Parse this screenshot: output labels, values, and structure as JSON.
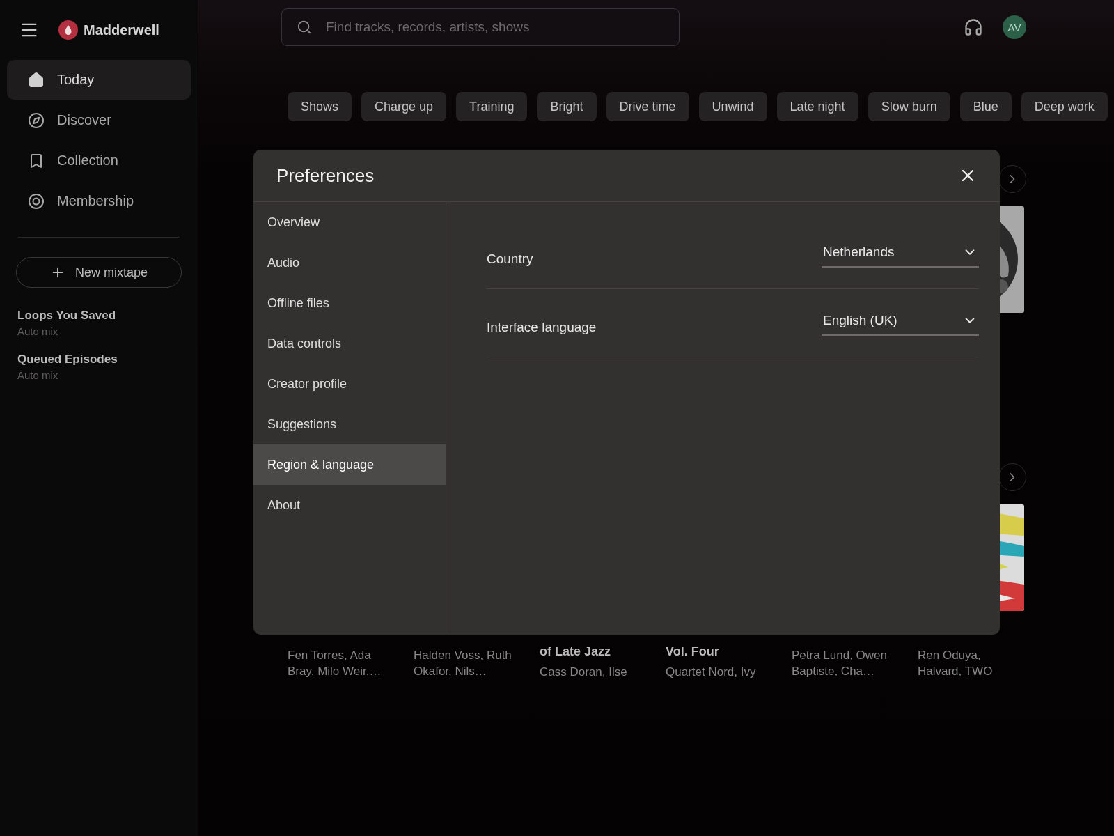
{
  "sidebar": {
    "brand": "Madderwell",
    "nav": [
      {
        "label": "Today",
        "selected": true
      },
      {
        "label": "Discover",
        "selected": false
      },
      {
        "label": "Collection",
        "selected": false
      },
      {
        "label": "Membership",
        "selected": false
      }
    ],
    "new_button": "New mixtape",
    "mixtapes": [
      {
        "title": "Loops You Saved",
        "subtitle": "Auto mix"
      },
      {
        "title": "Queued Episodes",
        "subtitle": "Auto mix"
      }
    ]
  },
  "topbar": {
    "search": {
      "placeholder": "Find tracks, records, artists, shows"
    },
    "avatar": "AV"
  },
  "chips": [
    "Shows",
    "Charge up",
    "Training",
    "Bright",
    "Drive time",
    "Unwind",
    "Late night",
    "Slow burn",
    "Blue",
    "Deep work"
  ],
  "shelves": [
    {
      "cover": {
        "kind": "picture"
      }
    },
    {
      "cover": {
        "kind": "picture"
      },
      "cards": [
        {
          "artists": "Fen Torres, Ada Bray, Milo Weir,…"
        },
        {
          "artists": "Halden Voss, Ruth Okafor, Nils…"
        },
        {
          "title_tail": "of Late Jazz",
          "artists": "Cass Doran, Ilse"
        },
        {
          "title_tail": "Vol. Four",
          "artists": "Quartet Nord, Ivy"
        },
        {
          "artists": "Petra Lund, Owen Baptiste, Cha…"
        },
        {
          "artists": "Ren Oduya, Halvard, TWO"
        }
      ]
    }
  ],
  "dialog": {
    "title": "Preferences",
    "tabs": [
      {
        "label": "Overview",
        "selected": false
      },
      {
        "label": "Audio",
        "selected": false
      },
      {
        "label": "Offline files",
        "selected": false
      },
      {
        "label": "Data controls",
        "selected": false
      },
      {
        "label": "Creator profile",
        "selected": false
      },
      {
        "label": "Suggestions",
        "selected": false
      },
      {
        "label": "Region & language",
        "selected": true
      },
      {
        "label": "About",
        "selected": false
      }
    ],
    "settings": [
      {
        "label": "Country",
        "value": "Netherlands"
      },
      {
        "label": "Interface language",
        "value": "English (UK)"
      }
    ]
  }
}
